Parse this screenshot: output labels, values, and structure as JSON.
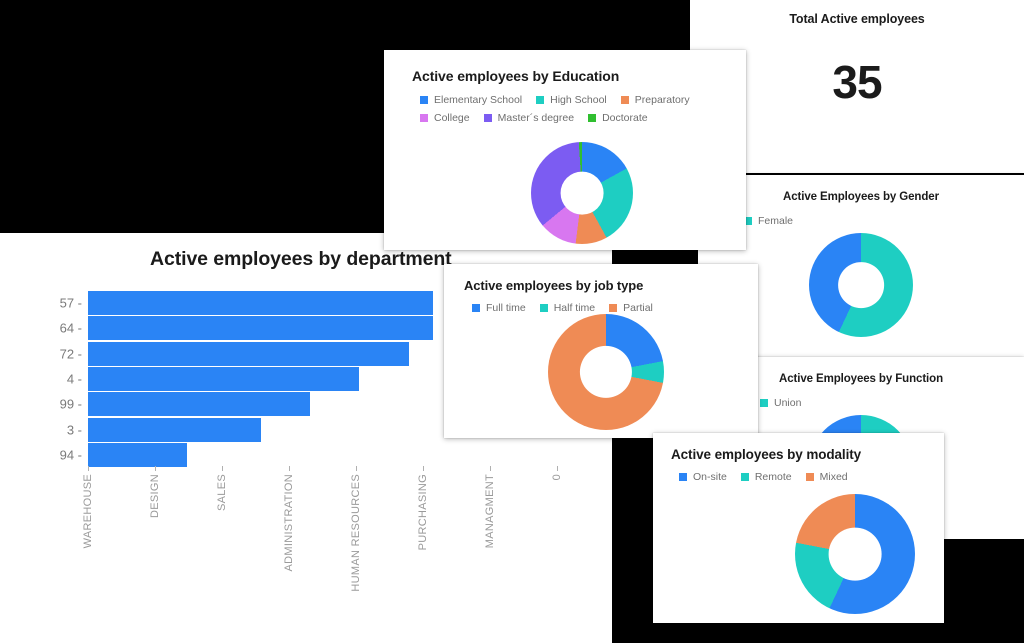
{
  "colors": {
    "blue": "#2a84f5",
    "teal": "#1ecec2",
    "orange": "#ef8b55",
    "magenta": "#d877f0",
    "purple": "#7c5cf2",
    "green": "#30bf30",
    "text_dark": "#1b1b1b",
    "text_muted": "#6f6f6f",
    "background": "#000000",
    "card": "#ffffff"
  },
  "total_card": {
    "title": "Total Active employees",
    "value": "35"
  },
  "education_card": {
    "title": "Active employees by Education"
  },
  "jobtype_card": {
    "title": "Active employees by job type"
  },
  "modality_card": {
    "title": "Active employees by modality"
  },
  "gender_card": {
    "title": "Active Employees by Gender"
  },
  "function_card": {
    "title": "Active Employees by Function"
  },
  "chart_data": [
    {
      "type": "bar",
      "title": "Active employees by department",
      "orientation": "horizontal",
      "xlabel": "",
      "ylabel": "",
      "categories": [
        "57",
        "64",
        "72",
        "4",
        "99",
        "3",
        "94"
      ],
      "values": [
        7.0,
        7.0,
        6.5,
        5.5,
        4.5,
        3.5,
        2.0
      ],
      "xtick_labels": [
        "WAREHOUSE",
        "DESIGN",
        "SALES",
        "ADMINISTRATION",
        "HUMAN RESOURCES",
        "PURCHASING",
        "MANAGMENT",
        "0"
      ],
      "xlim": [
        7.5,
        0
      ],
      "grid": false,
      "series_color": "#2a84f5"
    },
    {
      "type": "pie",
      "subtype": "donut",
      "title": "Active employees by Education",
      "legend_position": "top",
      "labels": [
        "Elementary School",
        "High School",
        "Preparatory",
        "College",
        "Master´s degree",
        "Doctorate"
      ],
      "colors": [
        "#2a84f5",
        "#1ecec2",
        "#ef8b55",
        "#d877f0",
        "#7c5cf2",
        "#30bf30"
      ],
      "values": [
        17,
        25,
        10,
        12,
        35,
        1
      ]
    },
    {
      "type": "pie",
      "subtype": "donut",
      "title": "Active employees by job type",
      "legend_position": "top",
      "labels": [
        "Full time",
        "Half time",
        "Partial"
      ],
      "colors": [
        "#2a84f5",
        "#1ecec2",
        "#ef8b55"
      ],
      "values": [
        22,
        6,
        72
      ]
    },
    {
      "type": "pie",
      "subtype": "donut",
      "title": "Active employees by modality",
      "legend_position": "top",
      "labels": [
        "On-site",
        "Remote",
        "Mixed"
      ],
      "colors": [
        "#2a84f5",
        "#1ecec2",
        "#ef8b55"
      ],
      "values": [
        57,
        21,
        22
      ]
    },
    {
      "type": "pie",
      "subtype": "donut",
      "title": "Active Employees by Gender",
      "legend_position": "top-left",
      "labels": [
        "Female"
      ],
      "colors": [
        "#1ecec2",
        "#2a84f5"
      ],
      "values": [
        57,
        43
      ]
    },
    {
      "type": "pie",
      "subtype": "donut",
      "title": "Active Employees by Function",
      "legend_position": "top-left",
      "labels": [
        "Union"
      ],
      "colors": [
        "#1ecec2",
        "#2a84f5"
      ],
      "values": [
        50,
        50
      ]
    }
  ]
}
